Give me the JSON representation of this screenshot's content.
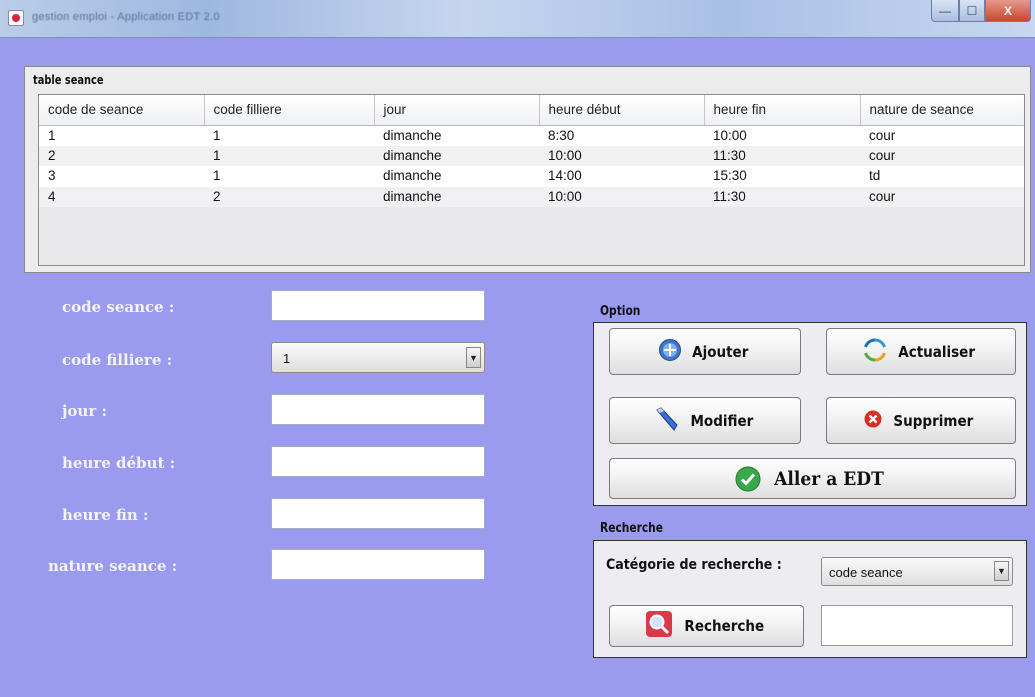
{
  "window": {
    "title": "gestion emploi - Application EDT 2.0",
    "min_glyph": "—",
    "max_glyph": "☐",
    "close_glyph": "X"
  },
  "table_panel": {
    "caption": "table seance",
    "columns": [
      "code de seance",
      "code filliere",
      "jour",
      "heure début",
      "heure fin",
      "nature de seance"
    ],
    "rows": [
      [
        "1",
        "1",
        "dimanche",
        "8:30",
        "10:00",
        "cour"
      ],
      [
        "2",
        "1",
        "dimanche",
        "10:00",
        "11:30",
        "cour"
      ],
      [
        "3",
        "1",
        "dimanche",
        "14:00",
        "15:30",
        "td"
      ],
      [
        "4",
        "2",
        "dimanche",
        "10:00",
        "11:30",
        "cour"
      ]
    ]
  },
  "form": {
    "code_seance_label": "code seance :",
    "code_filliere_label": "code filliere :",
    "code_filliere_value": "1",
    "jour_label": "jour :",
    "heure_debut_label": "heure début :",
    "heure_fin_label": "heure fin :",
    "nature_seance_label": "nature seance :"
  },
  "option": {
    "title": "Option",
    "ajouter": "Ajouter",
    "actualiser": "Actualiser",
    "modifier": "Modifier",
    "supprimer": "Supprimer",
    "aller_edt": "Aller a EDT"
  },
  "recherche": {
    "title": "Recherche",
    "categorie_label": "Catégorie de recherche :",
    "categorie_value": "code seance",
    "button": "Recherche"
  },
  "icons": {
    "ajouter": "globe-add-icon",
    "actualiser": "refresh-icon",
    "modifier": "pen-icon",
    "supprimer": "red-x-icon",
    "aller_edt": "green-check-icon",
    "recherche": "magnifier-icon"
  }
}
